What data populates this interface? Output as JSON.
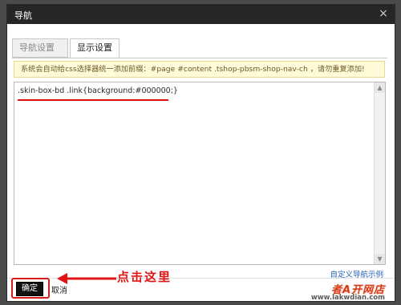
{
  "window": {
    "title": "导航",
    "close_symbol": "×"
  },
  "tabs": [
    {
      "label": "导航设置",
      "active": false
    },
    {
      "label": "显示设置",
      "active": true
    }
  ],
  "notice": "系统会自动给css选择器统一添加前缀：#page #content .tshop-pbsm-shop-nav-ch ，请勿重复添加!",
  "editor": {
    "value": ".skin-box-bd .link{background:#000000;}"
  },
  "custom_link": "自定义导航示例",
  "buttons": {
    "ok": "确定",
    "cancel": "取消"
  },
  "annotation": {
    "text": "点击这里"
  },
  "watermark": {
    "logo": "者A开网店",
    "url": "www.lakwdian.com"
  },
  "colors": {
    "titlebar": "#262626",
    "annotation": "#e01414",
    "notice_bg": "#fffbd9",
    "link": "#2563b8"
  }
}
